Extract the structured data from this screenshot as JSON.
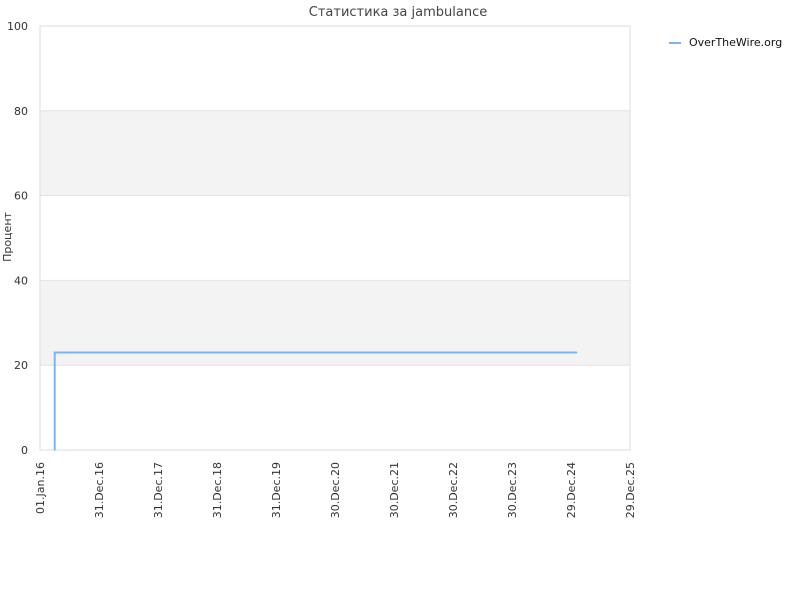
{
  "chart_data": {
    "type": "line",
    "title": "Статистика за jambulance",
    "xlabel": "",
    "ylabel": "Процент",
    "ylim": [
      0,
      100
    ],
    "y_ticks": [
      0,
      20,
      40,
      60,
      80,
      100
    ],
    "grid": true,
    "x_tick_labels": [
      "01.Jan.16",
      "31.Dec.16",
      "31.Dec.17",
      "31.Dec.18",
      "31.Dec.19",
      "30.Dec.20",
      "30.Dec.21",
      "30.Dec.22",
      "30.Dec.23",
      "29.Dec.24",
      "29.Dec.25"
    ],
    "legend_position": "top-right",
    "series": [
      {
        "name": "OverTheWire.org",
        "color": "#7cb5ec",
        "points": [
          {
            "x": "2016-04-01",
            "y": 0
          },
          {
            "x": "2016-04-01",
            "y": 23
          },
          {
            "x": "2025-02-01",
            "y": 23
          }
        ]
      }
    ]
  }
}
